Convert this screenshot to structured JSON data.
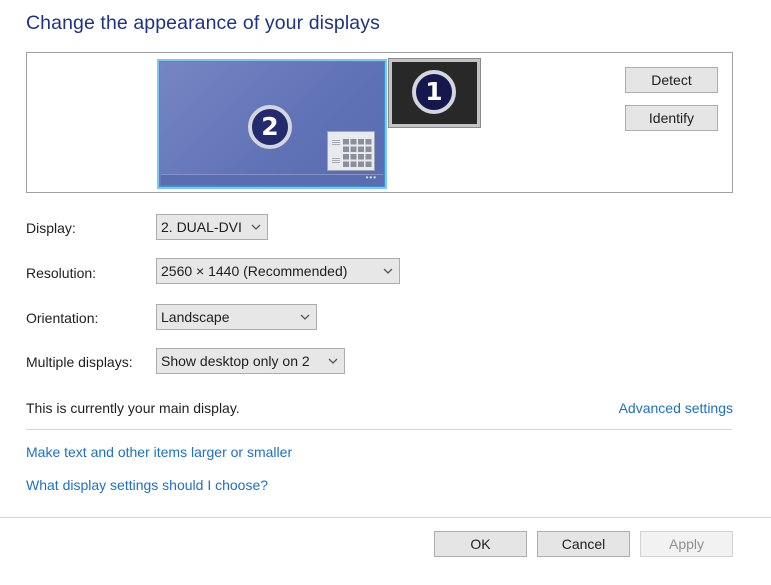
{
  "page": {
    "title": "Change the appearance of your displays"
  },
  "preview": {
    "monitors": [
      {
        "number": "1",
        "selected": false,
        "icon": "monitor-icon"
      },
      {
        "number": "2",
        "selected": true,
        "icon": "monitor-icon",
        "taskbar_dots": "•••"
      }
    ],
    "detect_label": "Detect",
    "identify_label": "Identify"
  },
  "settings": {
    "display": {
      "label": "Display:",
      "value": "2. DUAL-DVI"
    },
    "resolution": {
      "label": "Resolution:",
      "value": "2560 × 1440 (Recommended)"
    },
    "orientation": {
      "label": "Orientation:",
      "value": "Landscape"
    },
    "multiple_displays": {
      "label": "Multiple displays:",
      "value": "Show desktop only on 2"
    }
  },
  "status_text": "This is currently your main display.",
  "links": {
    "advanced": "Advanced settings",
    "text_size": "Make text and other items larger or smaller",
    "help": "What display settings should I choose?"
  },
  "footer": {
    "ok_label": "OK",
    "cancel_label": "Cancel",
    "apply_label": "Apply",
    "apply_enabled": false
  },
  "colors": {
    "title": "#1e3287",
    "link": "#1d6fc8",
    "selected_monitor": "#6576b8",
    "selected_border": "#7fc6f0"
  }
}
